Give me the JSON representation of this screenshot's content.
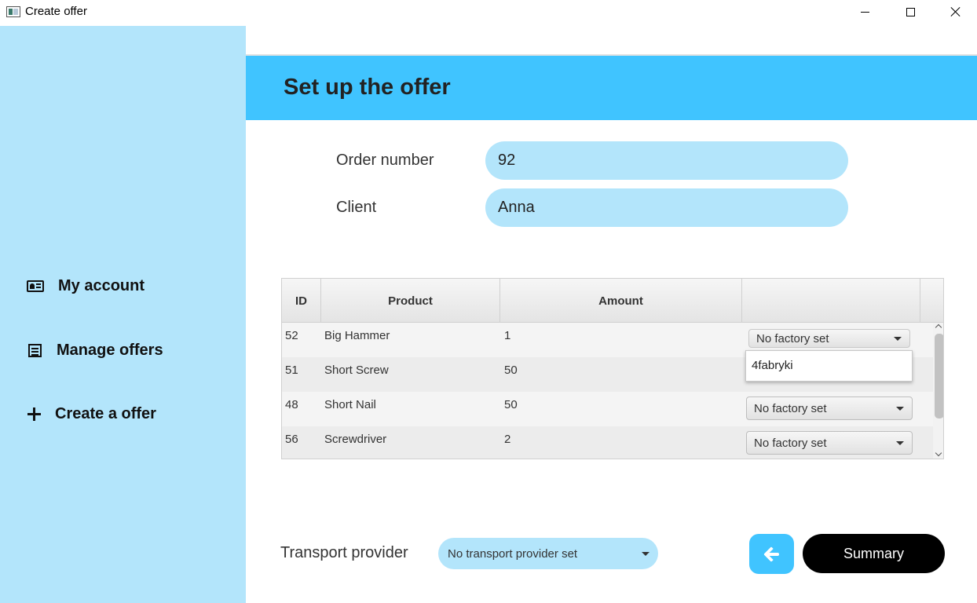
{
  "window": {
    "title": "Create offer"
  },
  "sidebar": {
    "items": [
      {
        "label": "My account",
        "icon": "id-card-icon"
      },
      {
        "label": "Manage offers",
        "icon": "list-icon"
      },
      {
        "label": "Create a offer",
        "icon": "plus-icon"
      }
    ]
  },
  "header": {
    "title": "Set up the offer"
  },
  "form": {
    "order_label": "Order number",
    "order_value": "92",
    "client_label": "Client",
    "client_value": "Anna"
  },
  "table": {
    "columns": [
      "ID",
      "Product",
      "Amount",
      ""
    ],
    "rows": [
      {
        "id": "52",
        "product": "Big Hammer",
        "amount": "1",
        "factory": "No factory set"
      },
      {
        "id": "51",
        "product": "Short Screw",
        "amount": "50",
        "factory": ""
      },
      {
        "id": "48",
        "product": "Short Nail",
        "amount": "50",
        "factory": "No factory set"
      },
      {
        "id": "56",
        "product": "Screwdriver",
        "amount": "2",
        "factory": "No factory set"
      }
    ],
    "open_dropdown_options": [
      "4fabryki"
    ]
  },
  "footer": {
    "transport_label": "Transport provider",
    "transport_value": "No transport provider set",
    "summary_label": "Summary"
  },
  "colors": {
    "sidebar_bg": "#b3e5fb",
    "header_bg": "#40c4ff",
    "input_bg": "#b3e5fb",
    "summary_bg": "#000000"
  }
}
